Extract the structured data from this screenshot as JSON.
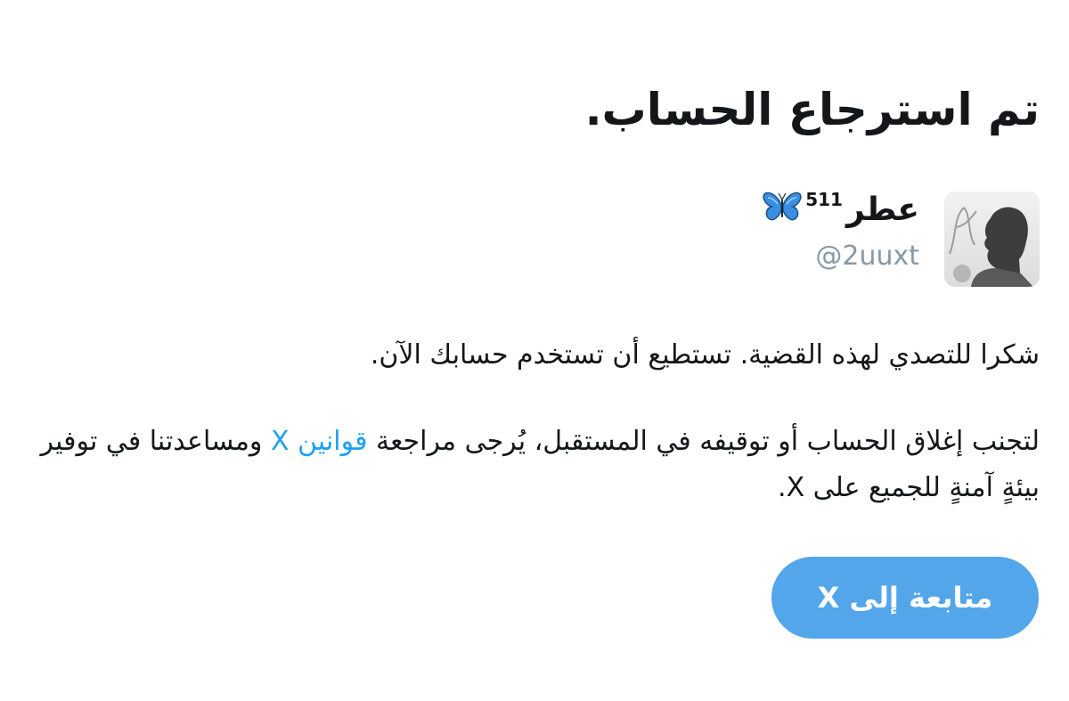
{
  "page": {
    "title": "تم استرجاع الحساب."
  },
  "account": {
    "display_name": "عطر",
    "display_name_sup": "511",
    "name_emoji_icon": "butterfly-icon",
    "handle": "@2uuxt"
  },
  "message": {
    "paragraph1": "شكرا للتصدي لهذه القضية. تستطيع أن تستخدم حسابك الآن.",
    "paragraph2_before_link": "لتجنب إغلاق الحساب أو توقيفه في المستقبل، يُرجى مراجعة ",
    "rules_link": "قوانين X",
    "paragraph2_after_link": " ومساعدتنا في توفير بيئةٍ آمنةٍ للجميع على X."
  },
  "actions": {
    "continue_label": "متابعة إلى X"
  },
  "colors": {
    "accent": "#1da1f2",
    "button": "#54a6ea",
    "handle_gray": "#8899a6",
    "text": "#14171a"
  }
}
